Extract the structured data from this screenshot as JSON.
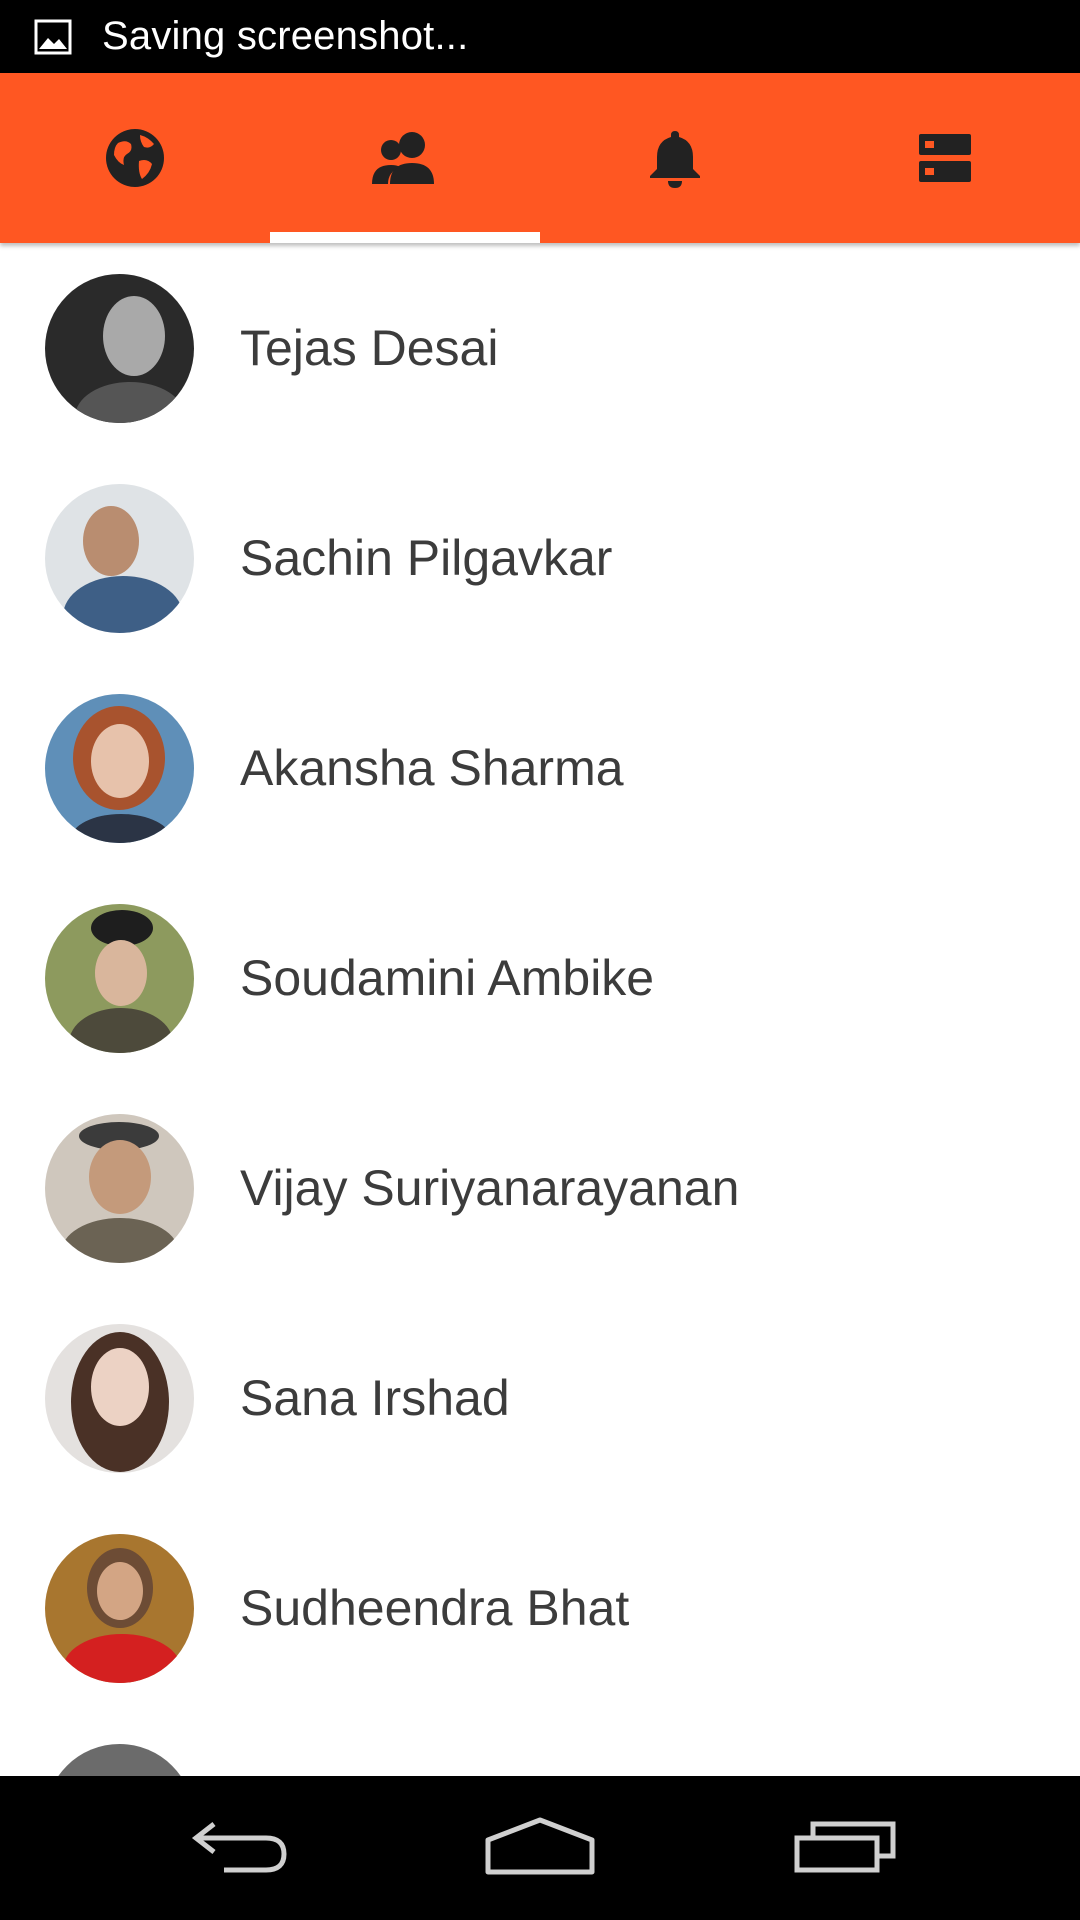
{
  "status_bar": {
    "icon": "image-icon",
    "text": "Saving screenshot..."
  },
  "tabs": [
    {
      "name": "world",
      "icon": "globe-icon",
      "selected": false
    },
    {
      "name": "people",
      "icon": "people-icon",
      "selected": true
    },
    {
      "name": "notifications",
      "icon": "bell-icon",
      "selected": false
    },
    {
      "name": "storage",
      "icon": "storage-icon",
      "selected": false
    }
  ],
  "contacts": [
    {
      "name": "Tejas Desai"
    },
    {
      "name": "Sachin Pilgavkar"
    },
    {
      "name": "Akansha Sharma"
    },
    {
      "name": "Soudamini Ambike"
    },
    {
      "name": "Vijay Suriyanarayanan"
    },
    {
      "name": "Sana Irshad"
    },
    {
      "name": "Sudheendra Bhat"
    },
    {
      "name": ""
    }
  ],
  "nav_bar": {
    "back": "back-icon",
    "home": "home-icon",
    "recents": "recents-icon"
  },
  "colors": {
    "accent": "#ff5722",
    "text": "#3c3c3c"
  }
}
